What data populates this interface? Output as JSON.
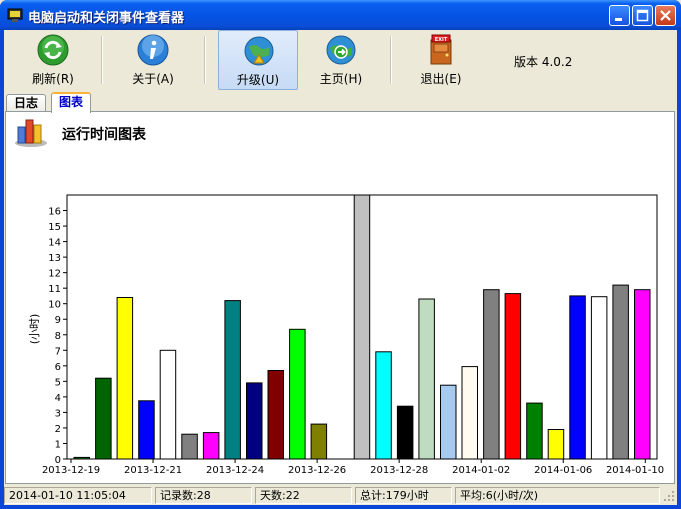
{
  "window": {
    "title": "电脑启动和关闭事件查看器"
  },
  "toolbar": {
    "buttons": [
      {
        "label": "刷新(R)",
        "icon": "refresh-icon"
      },
      {
        "label": "关于(A)",
        "icon": "info-icon"
      },
      {
        "label": "升级(U)",
        "icon": "upgrade-globe-icon"
      },
      {
        "label": "主页(H)",
        "icon": "home-globe-icon"
      },
      {
        "label": "退出(E)",
        "icon": "exit-door-icon"
      }
    ],
    "version": "版本 4.0.2"
  },
  "tabs": [
    {
      "label": "日志",
      "active": false
    },
    {
      "label": "图表",
      "active": true
    }
  ],
  "chart_title": "运行时间图表",
  "chart_data": {
    "type": "bar",
    "ylabel": "(小时)",
    "ylim": [
      0,
      17
    ],
    "yticks": [
      0,
      1,
      2,
      3,
      4,
      5,
      6,
      7,
      8,
      9,
      10,
      11,
      12,
      13,
      14,
      15,
      16
    ],
    "xticks": [
      "2013-12-19",
      "2013-12-21",
      "2013-12-24",
      "2013-12-26",
      "2013-12-28",
      "2014-01-02",
      "2014-01-06",
      "2014-01-10"
    ],
    "values": [
      0.1,
      5.2,
      10.4,
      3.75,
      7.0,
      1.6,
      1.7,
      10.2,
      4.9,
      5.7,
      8.35,
      2.25,
      null,
      17.0,
      6.9,
      3.4,
      10.3,
      4.75,
      5.95,
      10.9,
      10.65,
      3.6,
      1.9,
      10.5,
      10.45,
      11.2,
      10.9
    ],
    "colors": [
      "#008000",
      "#006400",
      "#ffff00",
      "#0000ff",
      "#ffffff",
      "#808080",
      "#ff00ff",
      "#008080",
      "#000080",
      "#800000",
      "#00ff00",
      "#808000",
      "#ffffff",
      "#c0c0c0",
      "#00ffff",
      "#000000",
      "#c0dcc0",
      "#a6caf0",
      "#fffbf0",
      "#808080",
      "#ff0000",
      "#008000",
      "#ffff00",
      "#0000ff",
      "#ffffff",
      "#808080",
      "#ff00ff"
    ]
  },
  "status": {
    "datetime": "2014-01-10 11:05:04",
    "records": "记录数:28",
    "days": "天数:22",
    "total": "总计:179小时",
    "average": "平均:6(小时/次)"
  }
}
